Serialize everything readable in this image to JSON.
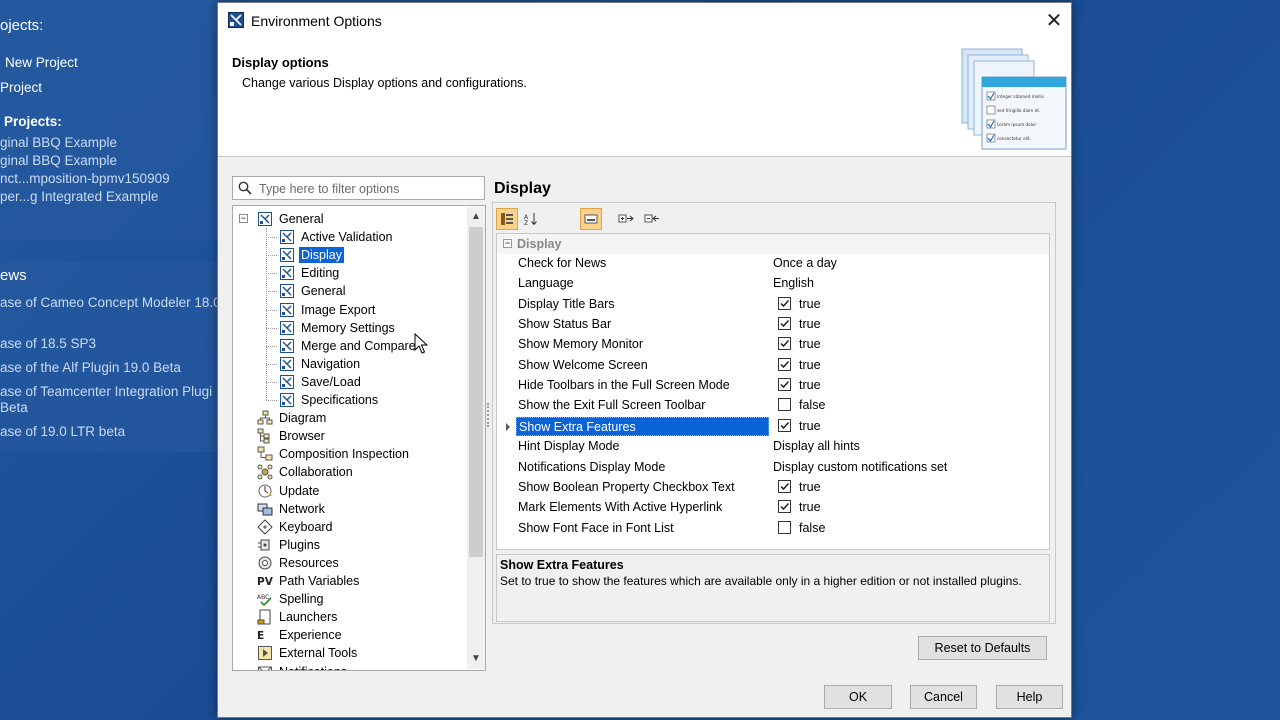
{
  "background": {
    "projects_heading": "ojects:",
    "links": [
      "New Project",
      "Project"
    ],
    "sample_heading": "Projects:",
    "samples": [
      "ginal BBQ Example",
      "ginal BBQ Example",
      "nct...mposition-bpmv150909",
      "per...g Integrated Example"
    ],
    "news_heading": "ews",
    "news": [
      "ase of Cameo Concept Modeler 18.0",
      "ase of 18.5 SP3",
      "ase of the Alf Plugin 19.0 Beta",
      "ase of Teamcenter Integration Plugi",
      "Beta",
      "ase of 19.0 LTR beta"
    ]
  },
  "dialog": {
    "title": "Environment Options",
    "close_glyph": "✕",
    "header": {
      "title": "Display options",
      "description": "Change various Display options and configurations.",
      "art_lines": [
        "Integer sitamed mollis",
        "sed fringilla diam et.",
        "Lorem ipsum dolor",
        "consectetur elit."
      ]
    },
    "filter_placeholder": "Type here to filter options",
    "tree": [
      {
        "label": "General",
        "icon": "general-icon",
        "expanded": true
      },
      {
        "label": "Active Validation",
        "icon": "option-icon"
      },
      {
        "label": "Display",
        "icon": "option-icon",
        "selected": true
      },
      {
        "label": "Editing",
        "icon": "option-icon"
      },
      {
        "label": "General",
        "icon": "option-icon"
      },
      {
        "label": "Image Export",
        "icon": "option-icon"
      },
      {
        "label": "Memory Settings",
        "icon": "option-icon"
      },
      {
        "label": "Merge and Compare",
        "icon": "option-icon"
      },
      {
        "label": "Navigation",
        "icon": "option-icon"
      },
      {
        "label": "Save/Load",
        "icon": "option-icon"
      },
      {
        "label": "Specifications",
        "icon": "option-icon"
      },
      {
        "label": "Diagram",
        "icon": "diagram-icon"
      },
      {
        "label": "Browser",
        "icon": "browser-icon"
      },
      {
        "label": "Composition Inspection",
        "icon": "composition-icon"
      },
      {
        "label": "Collaboration",
        "icon": "collaboration-icon"
      },
      {
        "label": "Update",
        "icon": "update-icon"
      },
      {
        "label": "Network",
        "icon": "network-icon"
      },
      {
        "label": "Keyboard",
        "icon": "keyboard-icon"
      },
      {
        "label": "Plugins",
        "icon": "plugins-icon"
      },
      {
        "label": "Resources",
        "icon": "resources-icon"
      },
      {
        "label": "Path Variables",
        "icon": "path-variables-icon",
        "icon_text": "PV"
      },
      {
        "label": "Spelling",
        "icon": "spelling-icon"
      },
      {
        "label": "Launchers",
        "icon": "launchers-icon"
      },
      {
        "label": "Experience",
        "icon": "experience-icon",
        "icon_text": "E"
      },
      {
        "label": "External Tools",
        "icon": "external-tools-icon"
      },
      {
        "label": "Notifications",
        "icon": "notifications-icon"
      }
    ],
    "right_title": "Display",
    "group_label": "Display",
    "properties": [
      {
        "name": "Check for News",
        "value": "Once a day"
      },
      {
        "name": "Language",
        "value": "English"
      },
      {
        "name": "Display Title Bars",
        "value": "true",
        "checkbox": true,
        "checked": true
      },
      {
        "name": "Show Status Bar",
        "value": "true",
        "checkbox": true,
        "checked": true
      },
      {
        "name": "Show Memory Monitor",
        "value": "true",
        "checkbox": true,
        "checked": true
      },
      {
        "name": "Show Welcome Screen",
        "value": "true",
        "checkbox": true,
        "checked": true
      },
      {
        "name": "Hide Toolbars in the Full Screen Mode",
        "value": "true",
        "checkbox": true,
        "checked": true
      },
      {
        "name": "Show the Exit Full Screen Toolbar",
        "value": "false",
        "checkbox": true,
        "checked": false
      },
      {
        "name": "Show Extra Features",
        "value": "true",
        "checkbox": true,
        "checked": true,
        "selected": true
      },
      {
        "name": "Hint Display Mode",
        "value": "Display all hints"
      },
      {
        "name": "Notifications Display Mode",
        "value": "Display custom notifications set"
      },
      {
        "name": "Show Boolean Property Checkbox Text",
        "value": "true",
        "checkbox": true,
        "checked": true
      },
      {
        "name": "Mark Elements With Active Hyperlink",
        "value": "true",
        "checkbox": true,
        "checked": true
      },
      {
        "name": "Show Font Face in Font List",
        "value": "false",
        "checkbox": true,
        "checked": false
      }
    ],
    "description": {
      "title": "Show Extra Features",
      "text": "Set to true to show the features which are available only in a higher edition or not installed plugins."
    },
    "buttons": {
      "reset": "Reset to Defaults",
      "ok": "OK",
      "cancel": "Cancel",
      "help": "Help"
    },
    "colors": {
      "selection": "#0a64d6",
      "toolbar_active": "#fbd28a",
      "background_blue": "#1c4f98"
    }
  }
}
